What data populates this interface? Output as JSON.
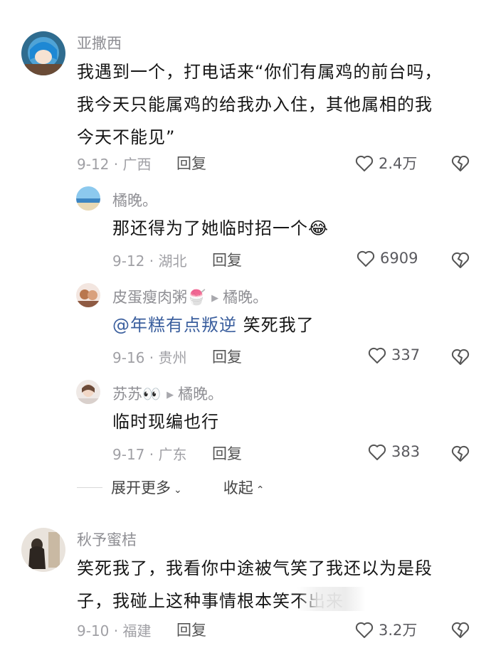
{
  "comments": [
    {
      "username": "亚撒西",
      "lines": [
        "我遇到一个，打电话来“你们有属鸡的前台吗，",
        "我今天只能属鸡的给我办入住，其他属相的我",
        "今天不能见”"
      ],
      "meta": "9-12 · 广西",
      "reply_label": "回复",
      "likes": "2.4万"
    },
    {
      "username": "橘晚。",
      "lines": [
        "那还得为了她临时招一个"
      ],
      "emoji": "😂",
      "meta": "9-12 · 湖北",
      "reply_label": "回复",
      "likes": "6909"
    },
    {
      "username": "皮蛋瘦肉粥",
      "username_emoji": "🍧",
      "reply_to": "橘晚。",
      "mention": "@年糕有点叛逆",
      "text": " 笑死我了",
      "meta": "9-16 · 贵州",
      "reply_label": "回复",
      "likes": "337"
    },
    {
      "username": "苏苏",
      "username_emoji": "👀",
      "reply_to": "橘晚。",
      "lines": [
        "临时现编也行"
      ],
      "meta": "9-17 · 广东",
      "reply_label": "回复",
      "likes": "383"
    },
    {
      "username": "秋予蜜桔",
      "lines": [
        "笑死我了，我看你中途被气笑了我还以为是段",
        "子，我碰上这种事情根本笑不出来"
      ],
      "meta": "9-10 · 福建",
      "reply_label": "回复",
      "likes": "3.2万"
    }
  ],
  "expand_more_label": "展开更多",
  "collapse_label": "收起",
  "colors": {
    "mention": "#3b5f9e",
    "meta": "#a0a0a5",
    "username": "#8f8f94"
  }
}
